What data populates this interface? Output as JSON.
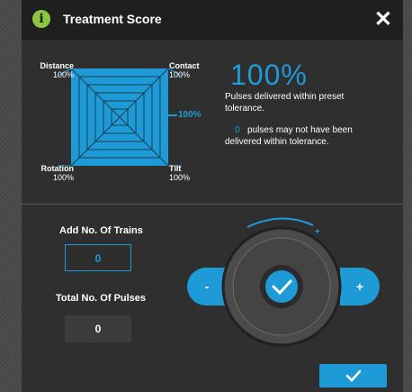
{
  "dialog": {
    "title": "Treatment Score",
    "close_glyph": "✕",
    "info_glyph": "i"
  },
  "radar": {
    "labels": {
      "distance": {
        "name": "Distance",
        "value": "100%"
      },
      "contact": {
        "name": "Contact",
        "value": "100%"
      },
      "rotation": {
        "name": "Rotation",
        "value": "100%"
      },
      "tilt": {
        "name": "Tilt",
        "value": "100%"
      }
    },
    "scale_marker": "100%"
  },
  "score": {
    "percent": "100%",
    "delivered_text": "Pulses delivered within preset tolerance.",
    "missed_count": "0",
    "missed_text": "pulses may not have been delivered within tolerance."
  },
  "trains": {
    "label": "Add No. Of Trains",
    "value": "0"
  },
  "pulses": {
    "label": "Total No. Of Pulses",
    "value": "0"
  },
  "knob": {
    "minus_label": "-",
    "plus_label": "+",
    "arc_plus": "+"
  },
  "colors": {
    "accent": "#1e9bd7",
    "info": "#8dc63f",
    "dialog_bg": "#2f2f2f",
    "titlebar_bg": "#1f1f1f"
  },
  "icons": {
    "info": "info-icon",
    "close": "close-icon",
    "confirm": "checkmark-icon"
  }
}
